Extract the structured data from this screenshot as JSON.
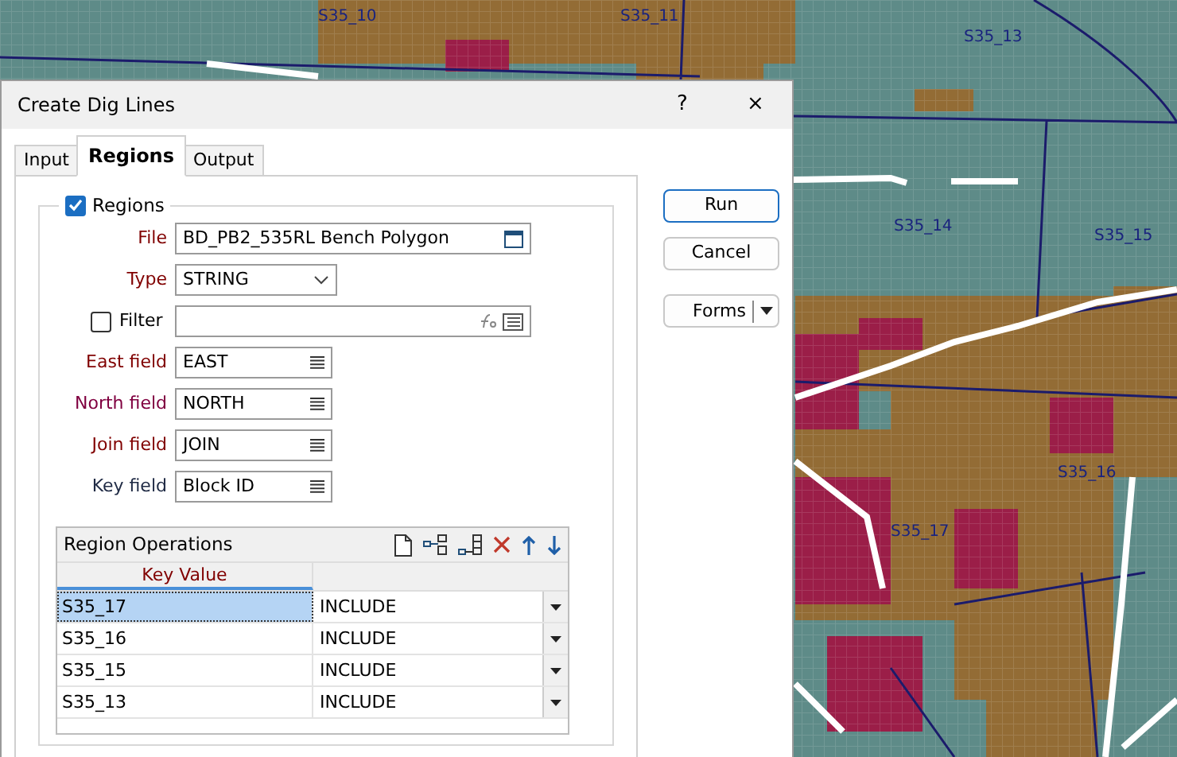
{
  "map_labels": [
    "S35_10",
    "S35_11",
    "S35_13",
    "S35_14",
    "S35_15",
    "S35_16",
    "S35_17"
  ],
  "window": {
    "title": "Create Dig Lines",
    "help": "?",
    "close": "×"
  },
  "tabs": [
    {
      "label": "Input",
      "selected": false
    },
    {
      "label": "Regions",
      "selected": true
    },
    {
      "label": "Output",
      "selected": false
    }
  ],
  "regions_group": {
    "label": "Regions",
    "checked": true
  },
  "fields": [
    {
      "kind": "file",
      "label": "File",
      "value": "BD_PB2_535RL Bench Polygon",
      "color": "#800000"
    },
    {
      "kind": "select",
      "label": "Type",
      "value": "STRING",
      "color": "#800000"
    },
    {
      "kind": "filter",
      "label": "Filter",
      "checked": false
    },
    {
      "kind": "list",
      "label": "East field",
      "value": "EAST",
      "color": "#800000"
    },
    {
      "kind": "list",
      "label": "North field",
      "value": "NORTH",
      "color": "#800040"
    },
    {
      "kind": "list",
      "label": "Join field",
      "value": "JOIN",
      "color": "#800000"
    },
    {
      "kind": "list",
      "label": "Key field",
      "value": "Block ID",
      "color": "#1f2a44"
    }
  ],
  "region_operations": {
    "title": "Region Operations",
    "columns": [
      "Key Value"
    ],
    "rows": [
      {
        "key": "S35_17",
        "operation": "INCLUDE",
        "selected": true
      },
      {
        "key": "S35_16",
        "operation": "INCLUDE",
        "selected": false
      },
      {
        "key": "S35_15",
        "operation": "INCLUDE",
        "selected": false
      },
      {
        "key": "S35_13",
        "operation": "INCLUDE",
        "selected": false
      }
    ]
  },
  "buttons": [
    {
      "kind": "default",
      "label": "Run"
    },
    {
      "kind": "normal",
      "label": "Cancel"
    },
    {
      "kind": "split",
      "label": "Forms"
    }
  ]
}
